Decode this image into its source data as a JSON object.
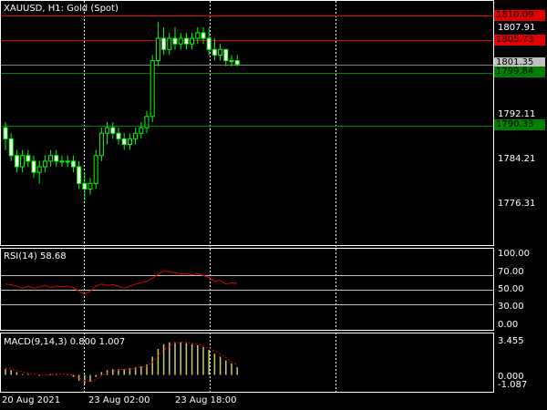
{
  "main": {
    "title": "XAUUSD, H1:  Gold (Spot)",
    "price_axis": [
      "1807.91",
      "1792.11",
      "1784.21",
      "1776.31"
    ],
    "tags": [
      {
        "text": "1810.09",
        "bg": "#e00000",
        "fg": "#000000"
      },
      {
        "text": "1805.73",
        "bg": "#e00000",
        "fg": "#000000"
      },
      {
        "text": "1801.35",
        "bg": "#c0c0c0",
        "fg": "#000000"
      },
      {
        "text": "1799.84",
        "bg": "#008000",
        "fg": "#000000"
      },
      {
        "text": "1790.33",
        "bg": "#008000",
        "fg": "#000000"
      }
    ],
    "candles": [
      [
        1790,
        1791,
        1786,
        1788
      ],
      [
        1788,
        1789,
        1784,
        1785
      ],
      [
        1785,
        1786,
        1782,
        1783
      ],
      [
        1783,
        1786,
        1782,
        1785
      ],
      [
        1785,
        1786,
        1783,
        1784
      ],
      [
        1784,
        1785,
        1781,
        1782
      ],
      [
        1782,
        1784,
        1780,
        1783
      ],
      [
        1783,
        1785,
        1782,
        1784
      ],
      [
        1784,
        1786,
        1783,
        1785
      ],
      [
        1785,
        1786,
        1783,
        1784
      ],
      [
        1784,
        1785,
        1783,
        1784
      ],
      [
        1784,
        1785,
        1783,
        1784
      ],
      [
        1784,
        1785,
        1782,
        1783
      ],
      [
        1783,
        1784,
        1779,
        1780
      ],
      [
        1780,
        1782,
        1777,
        1779
      ],
      [
        1779,
        1781,
        1778,
        1780
      ],
      [
        1780,
        1786,
        1779,
        1785
      ],
      [
        1785,
        1790,
        1784,
        1789
      ],
      [
        1789,
        1791,
        1787,
        1790
      ],
      [
        1790,
        1791,
        1788,
        1789
      ],
      [
        1789,
        1790,
        1787,
        1788
      ],
      [
        1788,
        1789,
        1786,
        1787
      ],
      [
        1787,
        1789,
        1786,
        1788
      ],
      [
        1788,
        1790,
        1787,
        1789
      ],
      [
        1789,
        1791,
        1788,
        1790
      ],
      [
        1790,
        1793,
        1789,
        1792
      ],
      [
        1792,
        1803,
        1791,
        1802
      ],
      [
        1802,
        1809,
        1801,
        1806
      ],
      [
        1806,
        1808,
        1803,
        1804
      ],
      [
        1804,
        1807,
        1803,
        1806
      ],
      [
        1806,
        1808,
        1804,
        1805
      ],
      [
        1805,
        1807,
        1804,
        1806
      ],
      [
        1806,
        1807,
        1804,
        1805
      ],
      [
        1805,
        1807,
        1804,
        1806
      ],
      [
        1806,
        1808,
        1805,
        1807
      ],
      [
        1807,
        1808,
        1805,
        1806
      ],
      [
        1806,
        1808,
        1803,
        1804
      ],
      [
        1804,
        1806,
        1802,
        1803
      ],
      [
        1803,
        1805,
        1802,
        1804
      ],
      [
        1804,
        1804,
        1801,
        1802
      ],
      [
        1802,
        1803,
        1801,
        1802
      ],
      [
        1802,
        1803,
        1801,
        1801.35
      ]
    ]
  },
  "rsi": {
    "title": "RSI(14) 58.68",
    "levels": [
      "100.00",
      "70.00",
      "50.00",
      "30.00",
      "0.00"
    ],
    "values": [
      58,
      57,
      55,
      52,
      55,
      52,
      54,
      56,
      53,
      55,
      54,
      55,
      53,
      48,
      44,
      48,
      55,
      58,
      56,
      57,
      55,
      52,
      55,
      58,
      60,
      62,
      66,
      72,
      77,
      75,
      74,
      72,
      73,
      71,
      73,
      70,
      67,
      62,
      63,
      58,
      60,
      58.68
    ]
  },
  "macd": {
    "title": "MACD(9,14,3) 0.800 1.007",
    "axis": [
      "3.455",
      "0.000",
      "-1.087"
    ],
    "hist": [
      0.6,
      0.5,
      0.3,
      0.1,
      0.1,
      0.0,
      -0.1,
      0.0,
      0.1,
      0.1,
      0.0,
      0.0,
      -0.2,
      -0.6,
      -0.9,
      -0.7,
      -0.2,
      0.3,
      0.5,
      0.6,
      0.6,
      0.6,
      0.7,
      0.8,
      0.9,
      1.1,
      1.9,
      2.7,
      3.2,
      3.4,
      3.4,
      3.4,
      3.3,
      3.2,
      3.1,
      2.9,
      2.6,
      2.2,
      1.9,
      1.5,
      1.2,
      0.8
    ],
    "signal": [
      0.7,
      0.6,
      0.5,
      0.3,
      0.2,
      0.1,
      0.0,
      0.0,
      0.0,
      0.1,
      0.1,
      0.0,
      0.0,
      -0.3,
      -0.6,
      -0.7,
      -0.5,
      -0.1,
      0.2,
      0.4,
      0.5,
      0.6,
      0.6,
      0.7,
      0.8,
      0.9,
      1.3,
      2.0,
      2.6,
      3.0,
      3.3,
      3.4,
      3.4,
      3.3,
      3.2,
      3.0,
      2.8,
      2.5,
      2.2,
      1.8,
      1.4,
      1.007
    ]
  },
  "time_axis": [
    "20 Aug 2021",
    "23 Aug 02:00",
    "23 Aug 18:00"
  ]
}
